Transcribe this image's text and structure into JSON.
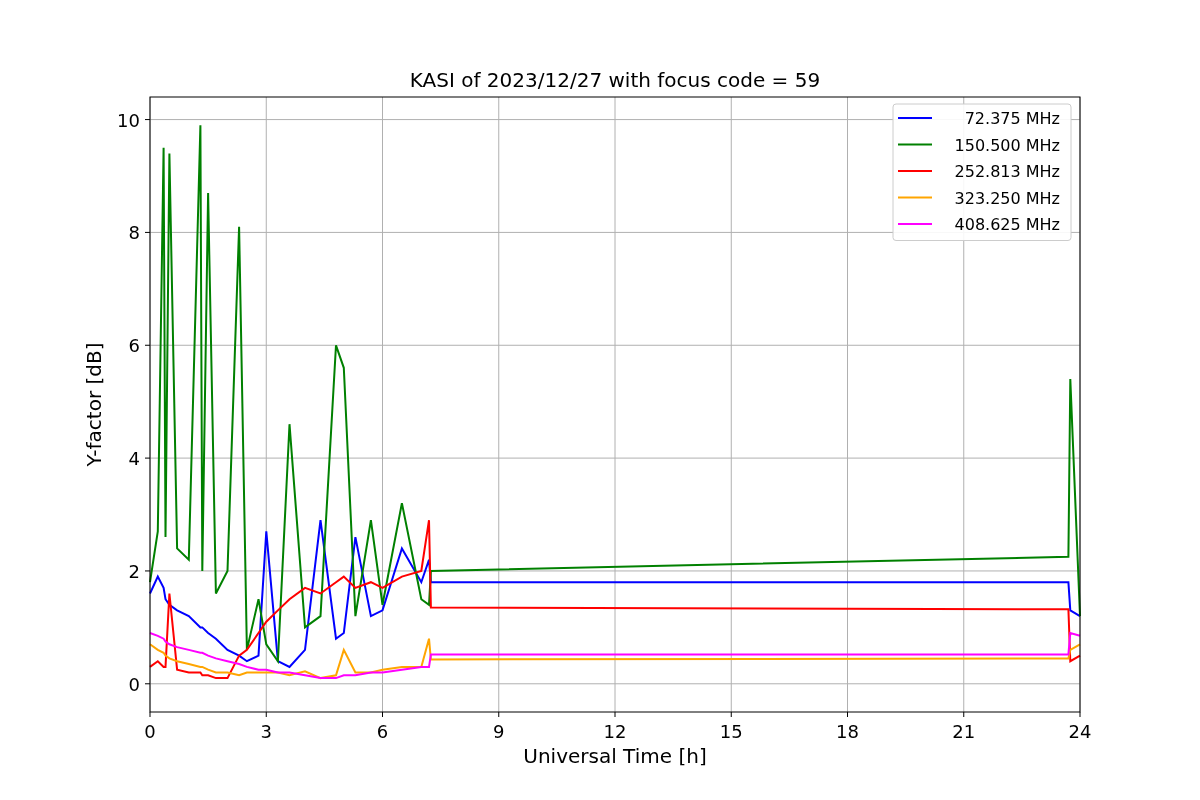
{
  "chart_data": {
    "type": "line",
    "title": "KASI of 2023/12/27 with focus code = 59",
    "xlabel": "Universal Time [h]",
    "ylabel": "Y-factor [dB]",
    "x": [
      0,
      0.2,
      0.35,
      0.4,
      0.5,
      0.7,
      1,
      1.3,
      1.35,
      1.5,
      1.7,
      2,
      2.3,
      2.5,
      2.8,
      3,
      3.3,
      3.6,
      4,
      4.4,
      4.8,
      5,
      5.3,
      5.7,
      6,
      6.5,
      7,
      7.2,
      7.25,
      23.7,
      23.75,
      24
    ],
    "series": [
      {
        "name": "72.375 MHz",
        "color": "#0000ff",
        "values": [
          1.6,
          1.9,
          1.7,
          1.5,
          1.4,
          1.3,
          1.2,
          1.0,
          1.0,
          0.9,
          0.8,
          0.6,
          0.5,
          0.4,
          0.5,
          2.7,
          0.4,
          0.3,
          0.6,
          2.9,
          0.8,
          0.9,
          2.6,
          1.2,
          1.3,
          2.4,
          1.8,
          2.2,
          1.8,
          1.8,
          1.3,
          1.2
        ]
      },
      {
        "name": "150.500 MHz",
        "color": "#008000",
        "values": [
          1.8,
          2.7,
          9.5,
          2.6,
          9.4,
          2.4,
          2.2,
          9.9,
          2.0,
          8.7,
          1.6,
          2.0,
          8.1,
          0.6,
          1.5,
          0.7,
          0.4,
          4.6,
          1.0,
          1.2,
          6.0,
          5.6,
          1.2,
          2.9,
          1.4,
          3.2,
          1.5,
          1.4,
          2.0,
          2.25,
          5.4,
          1.2
        ]
      },
      {
        "name": "252.813 MHz",
        "color": "#ff0000",
        "values": [
          0.3,
          0.4,
          0.3,
          0.3,
          1.6,
          0.25,
          0.2,
          0.2,
          0.15,
          0.15,
          0.1,
          0.1,
          0.5,
          0.6,
          0.9,
          1.1,
          1.3,
          1.5,
          1.7,
          1.6,
          1.8,
          1.9,
          1.7,
          1.8,
          1.7,
          1.9,
          2.0,
          2.9,
          1.35,
          1.32,
          0.4,
          0.5
        ]
      },
      {
        "name": "323.250 MHz",
        "color": "#ffa500",
        "values": [
          0.7,
          0.6,
          0.55,
          0.5,
          0.45,
          0.4,
          0.35,
          0.3,
          0.3,
          0.25,
          0.2,
          0.2,
          0.15,
          0.2,
          0.2,
          0.2,
          0.2,
          0.15,
          0.22,
          0.1,
          0.15,
          0.6,
          0.2,
          0.2,
          0.25,
          0.3,
          0.3,
          0.8,
          0.43,
          0.45,
          0.6,
          0.7
        ]
      },
      {
        "name": "408.625 MHz",
        "color": "#ff00ff",
        "values": [
          0.9,
          0.85,
          0.8,
          0.75,
          0.7,
          0.65,
          0.6,
          0.55,
          0.55,
          0.5,
          0.45,
          0.4,
          0.35,
          0.3,
          0.25,
          0.25,
          0.2,
          0.2,
          0.15,
          0.1,
          0.1,
          0.15,
          0.15,
          0.2,
          0.2,
          0.25,
          0.3,
          0.3,
          0.52,
          0.52,
          0.9,
          0.85
        ]
      }
    ],
    "xlim": [
      0,
      24
    ],
    "ylim": [
      -0.5,
      10.4
    ],
    "xticks": [
      0,
      3,
      6,
      9,
      12,
      15,
      18,
      21,
      24
    ],
    "yticks": [
      0,
      2,
      4,
      6,
      8,
      10
    ],
    "grid": true,
    "legend": true
  }
}
